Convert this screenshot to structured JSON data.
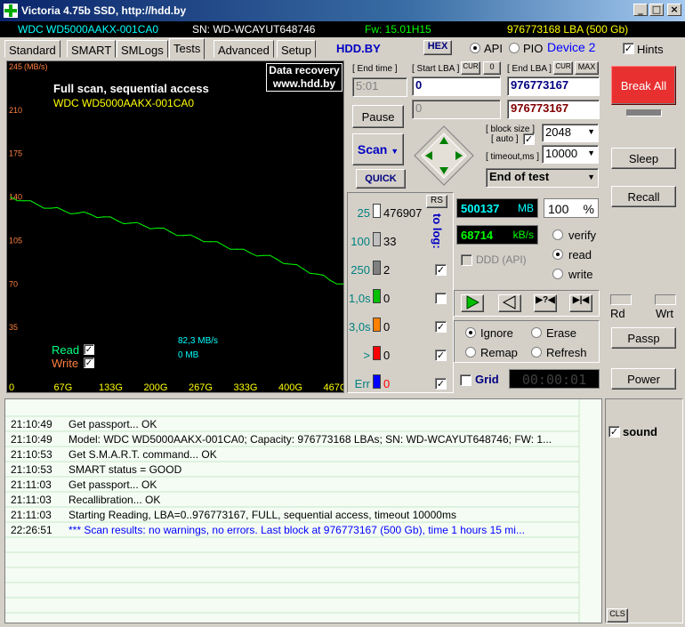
{
  "window": {
    "title": "Victoria 4.75b SSD, http://hdd.by",
    "min": "_",
    "max": "□",
    "close": "×"
  },
  "info": {
    "model": "WDC WD5000AAKX-001CA0",
    "serial": "SN: WD-WCAYUT648746",
    "firmware": "Fw: 15.01H15",
    "capacity": "976773168 LBA (500 Gb)"
  },
  "tabs": [
    "Standard",
    "SMART",
    "SMLogs",
    "Tests",
    "Advanced",
    "Setup"
  ],
  "active_tab": "Tests",
  "toolbar": {
    "brand": "HDD.BY",
    "hex": "HEX",
    "api": "API",
    "pio": "PIO",
    "device": "Device 2",
    "hints": "Hints"
  },
  "graph": {
    "ad_line1": "Data recovery",
    "ad_line2": "www.hdd.by",
    "heading": "Full scan, sequential access",
    "model": "WDC WD5000AAKX-001CA0",
    "yunit": "(MB/s)",
    "speed": "82,3 MB/s",
    "written": "0 MB",
    "read_label": "Read",
    "write_label": "Write",
    "yticks": [
      "245",
      "210",
      "175",
      "140",
      "105",
      "70",
      "35"
    ],
    "xticks": [
      "0",
      "67G",
      "133G",
      "200G",
      "267G",
      "333G",
      "400G",
      "467G"
    ]
  },
  "chart_data": {
    "type": "line",
    "xlabel": "",
    "ylabel": "(MB/s)",
    "ylim": [
      0,
      245
    ],
    "xlim": [
      0,
      500
    ],
    "x": [
      0,
      20,
      40,
      60,
      80,
      100,
      120,
      140,
      160,
      180,
      200,
      220,
      240,
      260,
      280,
      300,
      320,
      340,
      360,
      380,
      400,
      420,
      440,
      460,
      480,
      500
    ],
    "series": [
      {
        "name": "Read",
        "values": [
          140,
          137,
          134,
          131,
          129,
          127,
          126,
          124,
          121,
          119,
          117,
          115,
          112,
          109,
          107,
          104,
          101,
          98,
          95,
          93,
          90,
          86,
          82,
          78,
          73,
          70
        ]
      }
    ]
  },
  "controls": {
    "end_time_label": "[ End time ]",
    "start_lba_label": "[ Start LBA ]",
    "end_lba_label": "[ End LBA ]",
    "cur": "CUR",
    "zero": "0",
    "max": "MAX",
    "time": "5:01",
    "start_lba": "0",
    "end_lba": "976773167",
    "pos_lba": "0",
    "end_lba2": "976773167",
    "pause": "Pause",
    "scan": "Scan",
    "quick": "QUICK",
    "block_size_label": "[ block size ]",
    "auto_label": "[ auto ]",
    "block_size": "2048",
    "timeout_label": "[ timeout,ms ]",
    "timeout": "10000",
    "end_action": "End of test"
  },
  "stats": {
    "rs": "RS",
    "to_log": "to log:",
    "rows": [
      {
        "label": "25",
        "count": "476907",
        "color": "#ffffff"
      },
      {
        "label": "100",
        "count": "33",
        "color": "#c0c0c0"
      },
      {
        "label": "250",
        "count": "2",
        "color": "#808080"
      },
      {
        "label": "1,0s",
        "count": "0",
        "color": "#00c000"
      },
      {
        "label": "3,0s",
        "count": "0",
        "color": "#ff8000"
      },
      {
        "label": ">",
        "count": "0",
        "color": "#ff0000"
      },
      {
        "label": "Err",
        "count": "0",
        "color": "#0000ff"
      }
    ]
  },
  "readout": {
    "mb": "500137",
    "mb_unit": "MB",
    "pct": "100",
    "pct_unit": "%",
    "kbs": "68714",
    "kbs_unit": "kB/s",
    "ddd": "DDD (API)",
    "verify": "verify",
    "read": "read",
    "write": "write"
  },
  "actions": {
    "ignore": "Ignore",
    "erase": "Erase",
    "remap": "Remap",
    "refresh": "Refresh",
    "grid": "Grid",
    "timer": "00:00:01"
  },
  "right": {
    "break_all": "Break All",
    "sleep": "Sleep",
    "recall": "Recall",
    "rd": "Rd",
    "wrt": "Wrt",
    "passp": "Passp",
    "power": "Power",
    "sound": "sound",
    "cls": "CLS"
  },
  "log": [
    {
      "time": "21:10:49",
      "msg": "Get passport... OK"
    },
    {
      "time": "21:10:49",
      "msg": "Model: WDC WD5000AAKX-001CA0; Capacity: 976773168 LBAs; SN: WD-WCAYUT648746; FW: 1..."
    },
    {
      "time": "21:10:53",
      "msg": "Get S.M.A.R.T. command... OK"
    },
    {
      "time": "21:10:53",
      "msg": "SMART status = GOOD"
    },
    {
      "time": "21:11:03",
      "msg": "Get passport... OK"
    },
    {
      "time": "21:11:03",
      "msg": "Recallibration... OK"
    },
    {
      "time": "21:11:03",
      "msg": "Starting Reading, LBA=0..976773167, FULL, sequential access, timeout 10000ms"
    },
    {
      "time": "22:26:51",
      "msg": "*** Scan results: no warnings, no errors. Last block at 976773167 (500 Gb), time 1 hours 15 mi..."
    }
  ]
}
